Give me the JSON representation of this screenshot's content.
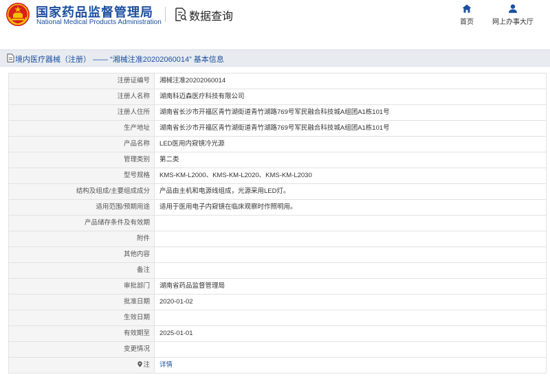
{
  "header": {
    "agency_cn": "国家药品监督管理局",
    "agency_en": "National Medical Products Administration",
    "query_title": "数据查询",
    "nav": {
      "home_label": "首页",
      "hall_label": "网上办事大厅"
    }
  },
  "title_bar": {
    "prefix": "境内医疗器械（注册）",
    "separator": "——",
    "suffix": "“湘械注准20202060014” 基本信息"
  },
  "rows": [
    {
      "label": "注册证编号",
      "value": "湘械注准20202060014"
    },
    {
      "label": "注册人名称",
      "value": "湖南科迈森医疗科技有限公司"
    },
    {
      "label": "注册人住所",
      "value": "湖南省长沙市开福区青竹湖街道青竹湖路769号军民融合科技城A组团A1栋101号"
    },
    {
      "label": "生产地址",
      "value": "湖南省长沙市开福区青竹湖街道青竹湖路769号军民融合科技城A组团A1栋101号"
    },
    {
      "label": "产品名称",
      "value": "LED医用内窥镜冷光源"
    },
    {
      "label": "管理类别",
      "value": "第二类"
    },
    {
      "label": "型号规格",
      "value": "KMS-KM-L2000、KMS-KM-L2020、KMS-KM-L2030"
    },
    {
      "label": "结构及组成/主要组成成分",
      "value": "产品由主机和电源线组成，光源采用LED灯。"
    },
    {
      "label": "适用范围/预期用途",
      "value": "适用于医用电子内窥镜在临床观察时作照明用。"
    },
    {
      "label": "产品储存条件及有效期",
      "value": ""
    },
    {
      "label": "附件",
      "value": ""
    },
    {
      "label": "其他内容",
      "value": ""
    },
    {
      "label": "备注",
      "value": ""
    },
    {
      "label": "审批部门",
      "value": "湖南省药品监督管理局"
    },
    {
      "label": "批准日期",
      "value": "2020-01-02"
    },
    {
      "label": "生效日期",
      "value": ""
    },
    {
      "label": "有效期至",
      "value": "2025-01-01"
    },
    {
      "label": "变更情况",
      "value": ""
    }
  ],
  "note": {
    "label": "注",
    "link_text": "详情"
  },
  "colors": {
    "brand_blue": "#1c4fa0",
    "emblem_red": "#d8201e",
    "emblem_gold": "#f5c000",
    "label_bg": "#f5f5f5",
    "title_bar_bg": "#e8ecf1"
  },
  "icons": {
    "emblem": "national-emblem-icon",
    "query": "document-search-icon",
    "home": "home-icon",
    "hall": "user-icon",
    "title": "document-icon",
    "note": "location-pin-icon"
  }
}
